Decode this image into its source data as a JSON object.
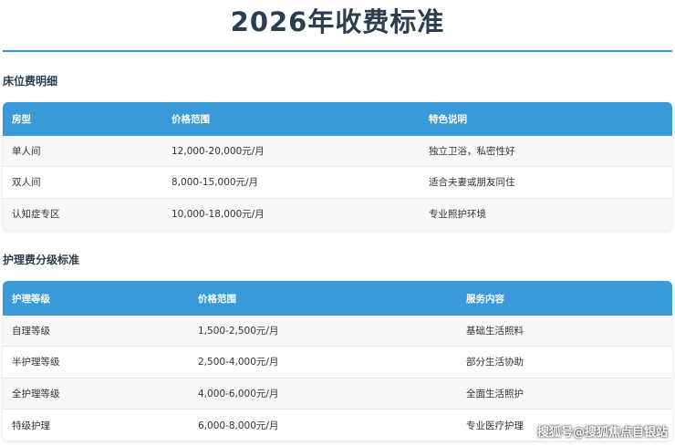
{
  "page": {
    "title": "2026年收费标准"
  },
  "bed_section": {
    "heading": "床位费明细",
    "columns": [
      "房型",
      "价格范围",
      "特色说明"
    ],
    "rows": [
      [
        "单人间",
        "12,000-20,000元/月",
        "独立卫浴，私密性好"
      ],
      [
        "双人间",
        "8,000-15,000元/月",
        "适合夫妻或朋友同住"
      ],
      [
        "认知症专区",
        "10,000-18,000元/月",
        "专业照护环境"
      ]
    ]
  },
  "care_section": {
    "heading": "护理费分级标准",
    "columns": [
      "护理等级",
      "价格范围",
      "服务内容"
    ],
    "rows": [
      [
        "自理等级",
        "1,500-2,500元/月",
        "基础生活照料"
      ],
      [
        "半护理等级",
        "2,500-4,000元/月",
        "部分生活协助"
      ],
      [
        "全护理等级",
        "4,000-6,000元/月",
        "全面生活照护"
      ],
      [
        "特级护理",
        "6,000-8,000元/月",
        "专业医疗护理"
      ]
    ]
  },
  "watermark": {
    "text": "搜狐号@搜狐焦点自银站"
  },
  "colors": {
    "header_blue": "#3a9ad9",
    "title_dark": "#2c3e50",
    "rule_blue": "#3a8fd4"
  }
}
